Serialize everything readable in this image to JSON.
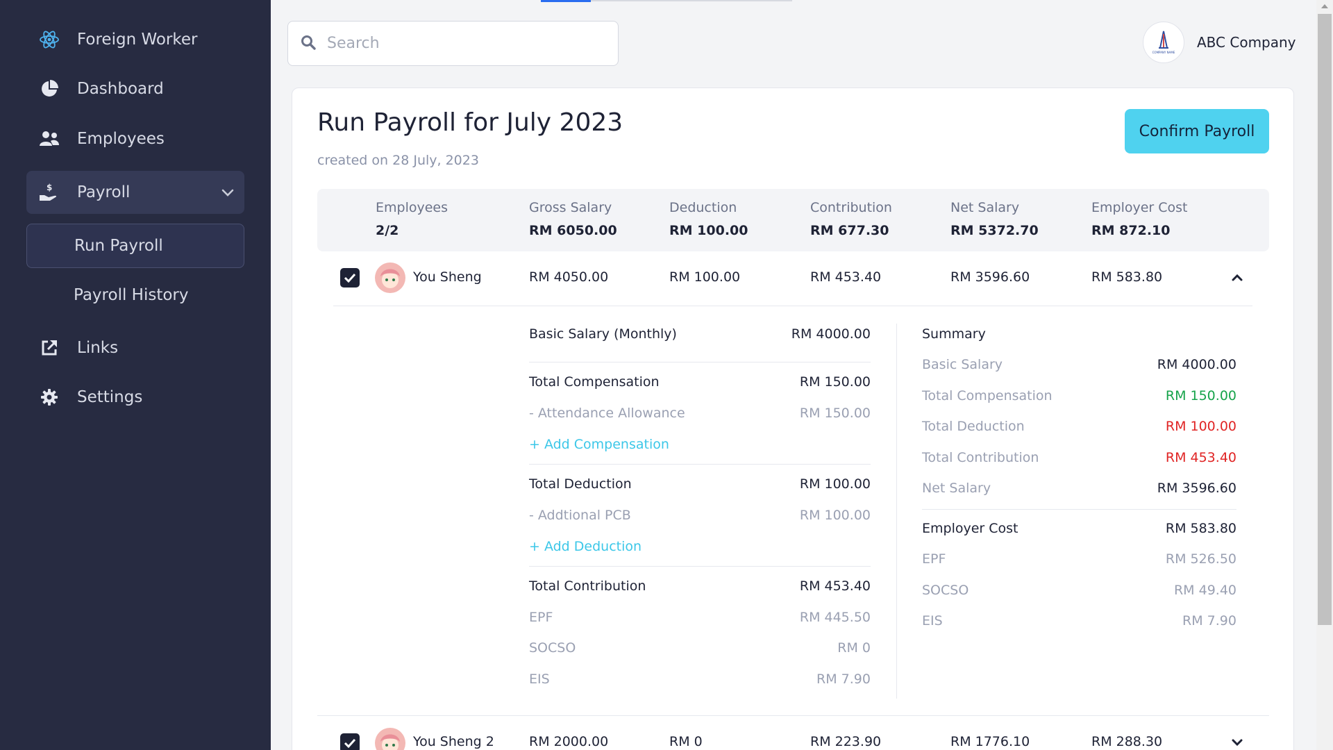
{
  "sidebar": {
    "items": [
      {
        "label": "Foreign Worker",
        "icon": "atom-icon"
      },
      {
        "label": "Dashboard",
        "icon": "pie-chart-icon"
      },
      {
        "label": "Employees",
        "icon": "users-icon"
      },
      {
        "label": "Payroll",
        "icon": "hand-dollar-icon"
      },
      {
        "label": "Run Payroll"
      },
      {
        "label": "Payroll History"
      },
      {
        "label": "Links",
        "icon": "external-link-icon"
      },
      {
        "label": "Settings",
        "icon": "gear-icon"
      }
    ]
  },
  "search": {
    "placeholder": "Search",
    "value": ""
  },
  "company": {
    "name": "ABC Company",
    "logo_text": "COMPANY NAME"
  },
  "page": {
    "title": "Run Payroll for July 2023",
    "created": "created on 28 July, 2023",
    "confirm_label": "Confirm Payroll"
  },
  "summary": {
    "headers": [
      "Employees",
      "Gross Salary",
      "Deduction",
      "Contribution",
      "Net Salary",
      "Employer Cost"
    ],
    "values": [
      "2/2",
      "RM 6050.00",
      "RM 100.00",
      "RM 677.30",
      "RM 5372.70",
      "RM 872.10"
    ]
  },
  "employees": [
    {
      "name": "You Sheng",
      "gross": "RM 4050.00",
      "deduction": "RM 100.00",
      "contribution": "RM 453.40",
      "net": "RM 3596.60",
      "employer_cost": "RM 583.80",
      "checked": true,
      "expanded": true
    },
    {
      "name": "You Sheng 2",
      "gross": "RM 2000.00",
      "deduction": "RM 0",
      "contribution": "RM 223.90",
      "net": "RM 1776.10",
      "employer_cost": "RM 288.30",
      "checked": true,
      "expanded": false
    }
  ],
  "detail": {
    "basic_label": "Basic Salary (Monthly)",
    "basic_value": "RM 4000.00",
    "comp_label": "Total Compensation",
    "comp_value": "RM 150.00",
    "comp_item_label": "- Attendance Allowance",
    "comp_item_value": "RM 150.00",
    "add_comp": "+ Add Compensation",
    "ded_label": "Total Deduction",
    "ded_value": "RM 100.00",
    "ded_item_label": "- Addtional PCB",
    "ded_item_value": "RM 100.00",
    "add_ded": "+ Add Deduction",
    "contrib_label": "Total Contribution",
    "contrib_value": "RM 453.40",
    "epf_label": "EPF",
    "epf_value": "RM 445.50",
    "socso_label": "SOCSO",
    "socso_value": "RM 0",
    "eis_label": "EIS",
    "eis_value": "RM 7.90"
  },
  "side_summary": {
    "title": "Summary",
    "basic_label": "Basic Salary",
    "basic_value": "RM 4000.00",
    "comp_label": "Total Compensation",
    "comp_value": "RM 150.00",
    "ded_label": "Total Deduction",
    "ded_value": "RM 100.00",
    "contrib_label": "Total Contribution",
    "contrib_value": "RM 453.40",
    "net_label": "Net Salary",
    "net_value": "RM 3596.60",
    "employer_label": "Employer Cost",
    "employer_value": "RM 583.80",
    "epf_label": "EPF",
    "epf_value": "RM 526.50",
    "socso_label": "SOCSO",
    "socso_value": "RM 49.40",
    "eis_label": "EIS",
    "eis_value": "RM 7.90"
  },
  "colors": {
    "sidebar": "#272b41",
    "accent": "#4fd2ef",
    "positive": "#16a34a",
    "negative": "#e02424"
  }
}
